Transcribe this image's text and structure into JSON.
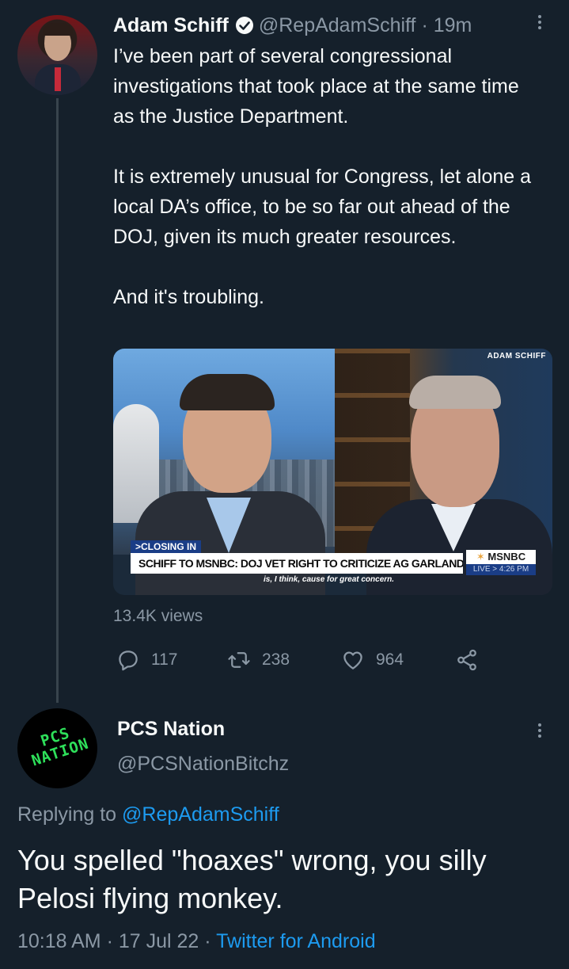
{
  "tweet": {
    "display_name": "Adam Schiff",
    "handle": "@RepAdamSchiff",
    "separator": "·",
    "time_ago": "19m",
    "paragraphs": [
      "I’ve been part of several congressional investigations that took place at the same time as the Justice Department.",
      "It is extremely unusual for Congress, let alone a local DA’s office, to be so far out ahead of the DOJ, given its much greater resources.",
      "And it's troubling."
    ],
    "media": {
      "logo_tag": "ADAM SCHIFF",
      "lower_third_tag": ">CLOSING IN",
      "headline": "SCHIFF TO MSNBC: DOJ VET RIGHT TO CRITICIZE AG GARLAND",
      "network": "MSNBC",
      "live": "LIVE > 4:26 PM",
      "caption": "is, I think, cause for great concern."
    },
    "views": "13.4K views",
    "actions": {
      "replies": "117",
      "retweets": "238",
      "likes": "964"
    }
  },
  "reply": {
    "avatar_text_line1": "PCS",
    "avatar_text_line2": "NATION",
    "display_name": "PCS Nation",
    "handle": "@PCSNationBitchz",
    "replying_prefix": "Replying to",
    "replying_to": "@RepAdamSchiff",
    "text": "You spelled \"hoaxes\" wrong, you silly Pelosi flying monkey.",
    "time": "10:18 AM",
    "date": "17 Jul 22",
    "separator": "·",
    "source": "Twitter for Android"
  },
  "colors": {
    "background": "#15202b",
    "text_primary": "#f7f9f9",
    "text_secondary": "#8b98a5",
    "accent": "#1d9bf0",
    "thread_line": "#38444d"
  }
}
